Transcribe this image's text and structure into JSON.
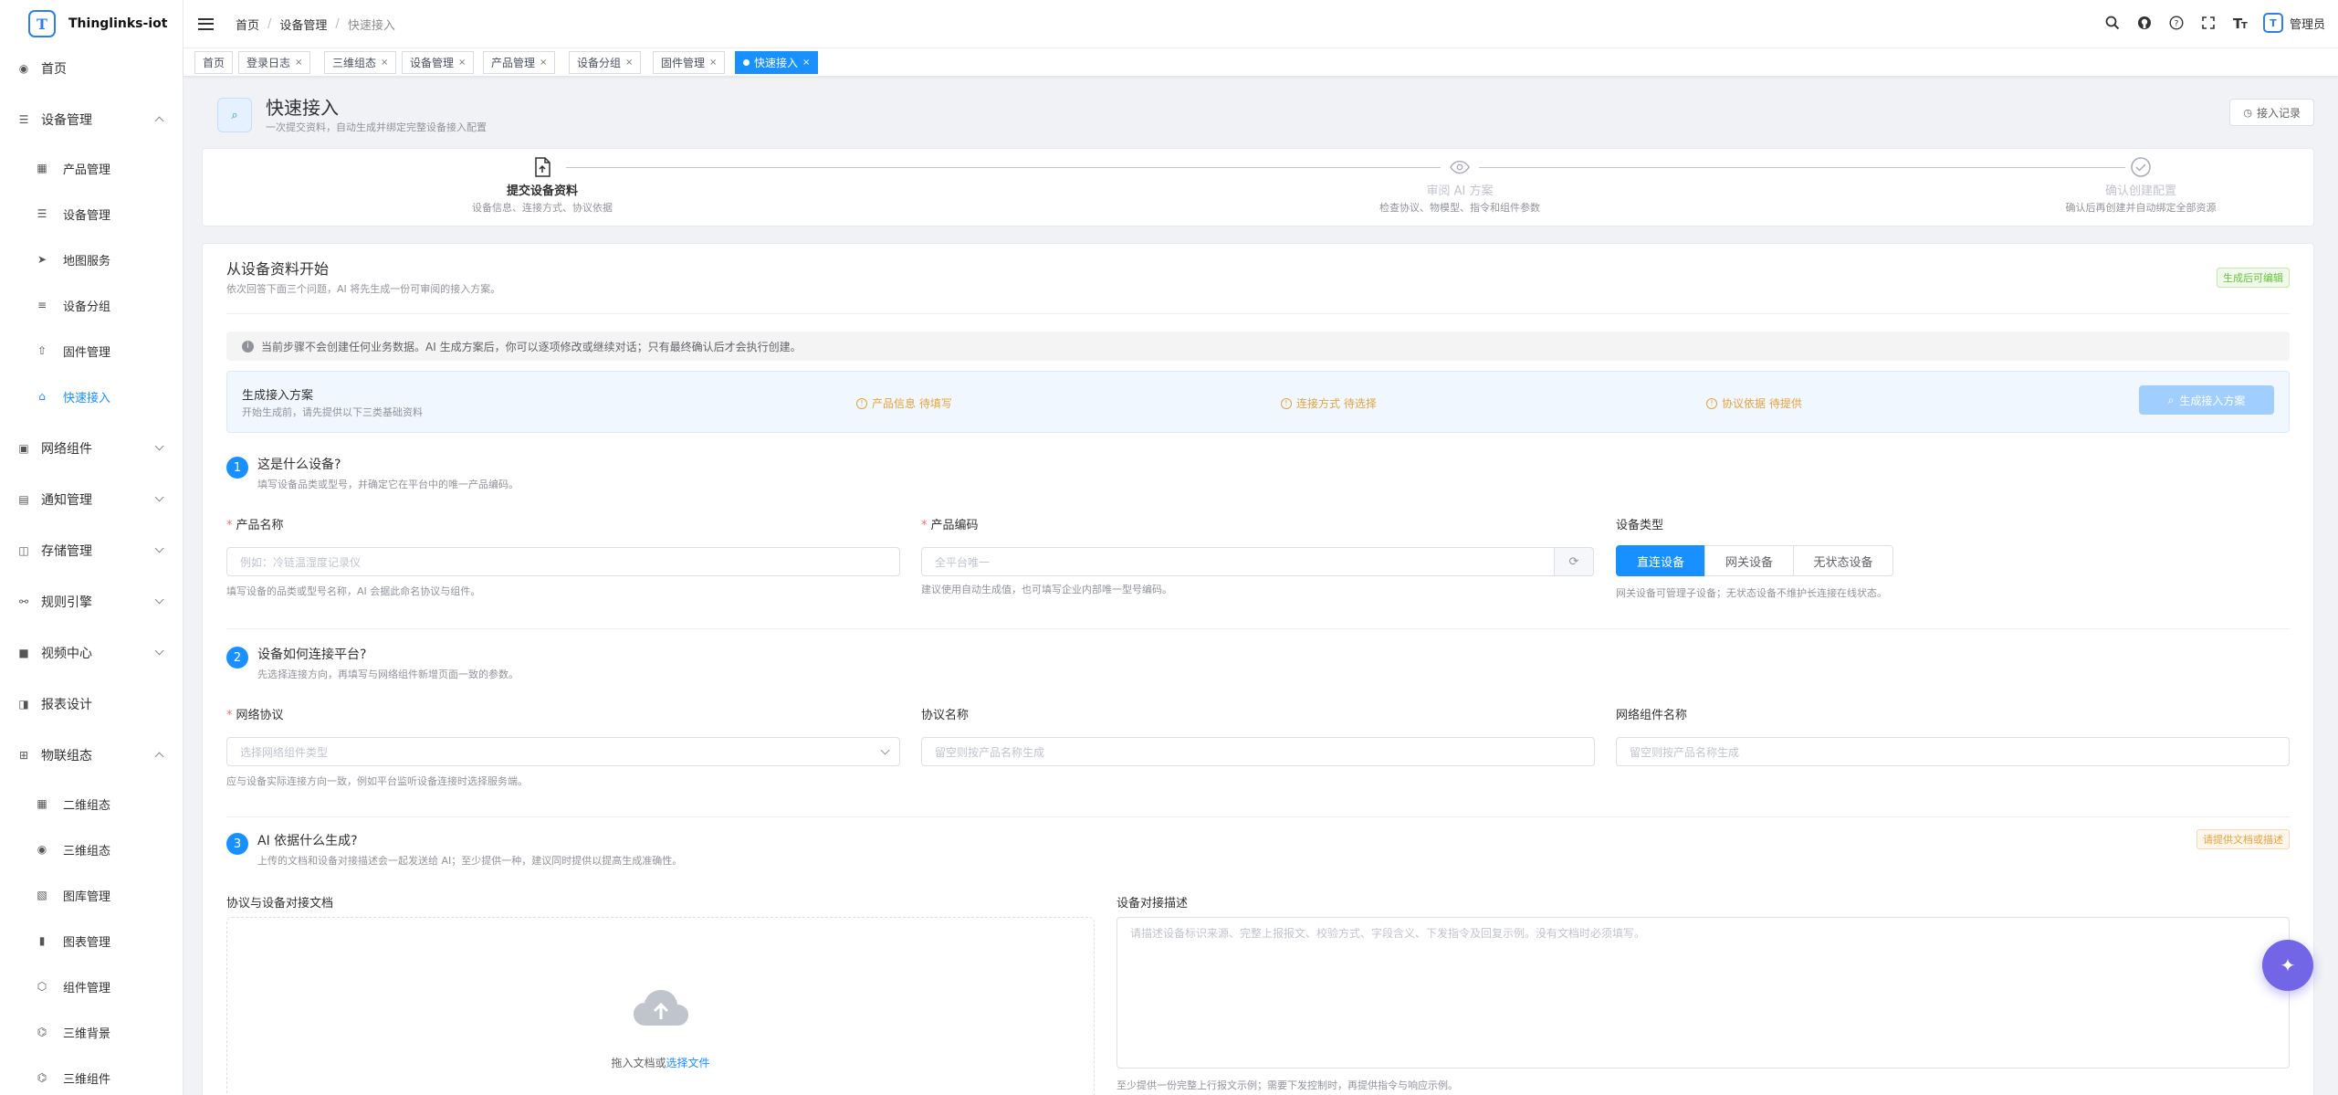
{
  "app": {
    "name": "Thinglinks-iot",
    "logo": "T"
  },
  "sidebar": {
    "items": [
      {
        "label": "首页",
        "icon": "dashboard-icon"
      },
      {
        "label": "设备管理",
        "icon": "device-stack-icon"
      },
      {
        "label": "产品管理",
        "icon": "grid-icon"
      },
      {
        "label": "设备管理",
        "icon": "device-stack-icon"
      },
      {
        "label": "地图服务",
        "icon": "send-icon"
      },
      {
        "label": "设备分组",
        "icon": "list-icon"
      },
      {
        "label": "固件管理",
        "icon": "upload-icon"
      },
      {
        "label": "快速接入",
        "icon": "home-icon"
      },
      {
        "label": "网络组件",
        "icon": "network-icon"
      },
      {
        "label": "通知管理",
        "icon": "message-icon"
      },
      {
        "label": "存储管理",
        "icon": "storage-icon"
      },
      {
        "label": "规则引擎",
        "icon": "rule-icon"
      },
      {
        "label": "视频中心",
        "icon": "video-icon"
      },
      {
        "label": "报表设计",
        "icon": "report-icon"
      },
      {
        "label": "物联组态",
        "icon": "config-icon"
      },
      {
        "label": "二维组态",
        "icon": "grid-icon"
      },
      {
        "label": "三维组态",
        "icon": "dashboard-icon"
      },
      {
        "label": "图库管理",
        "icon": "image-icon"
      },
      {
        "label": "图表管理",
        "icon": "bar-chart-icon"
      },
      {
        "label": "组件管理",
        "icon": "component-icon"
      },
      {
        "label": "三维背景",
        "icon": "background-icon"
      },
      {
        "label": "三维组件",
        "icon": "background-icon"
      }
    ]
  },
  "breadcrumb": [
    "首页",
    "设备管理",
    "快速接入"
  ],
  "header": {
    "admin": "管理员",
    "avatar": "T"
  },
  "tabs": [
    "首页",
    "登录日志",
    "三维组态",
    "设备管理",
    "产品管理",
    "设备分组",
    "固件管理",
    "快速接入"
  ],
  "page": {
    "title": "快速接入",
    "subtitle": "一次提交资料，自动生成并绑定完整设备接入配置",
    "records_btn": "接入记录"
  },
  "steps": [
    {
      "title": "提交设备资料",
      "desc": "设备信息、连接方式、协议依据"
    },
    {
      "title": "审阅 AI 方案",
      "desc": "检查协议、物模型、指令和组件参数"
    },
    {
      "title": "确认创建配置",
      "desc": "确认后再创建并自动绑定全部资源"
    }
  ],
  "form": {
    "title": "从设备资料开始",
    "subtitle": "依次回答下面三个问题，AI 将先生成一份可审阅的接入方案。",
    "badge": "生成后可编辑",
    "notice": "当前步骤不会创建任何业务数据。AI 生成方案后，你可以逐项修改或继续对话；只有最终确认后才会执行创建。",
    "gen": {
      "title": "生成接入方案",
      "sub": "开始生成前，请先提供以下三类基础资料",
      "s1": "产品信息 待填写",
      "s2": "连接方式 待选择",
      "s3": "协议依据 待提供",
      "btn": "生成接入方案"
    },
    "q1": {
      "num": "1",
      "title": "这是什么设备?",
      "desc": "填写设备品类或型号，并确定它在平台中的唯一产品编码。",
      "name_label": "产品名称",
      "name_ph": "例如：冷链温湿度记录仪",
      "name_hint": "填写设备的品类或型号名称，AI 会据此命名协议与组件。",
      "code_label": "产品编码",
      "code_ph": "全平台唯一",
      "code_hint": "建议使用自动生成值，也可填写企业内部唯一型号编码。",
      "type_label": "设备类型",
      "types": [
        "直连设备",
        "网关设备",
        "无状态设备"
      ],
      "type_hint": "网关设备可管理子设备；无状态设备不维护长连接在线状态。"
    },
    "q2": {
      "num": "2",
      "title": "设备如何连接平台?",
      "desc": "先选择连接方向，再填写与网络组件新增页面一致的参数。",
      "proto_label": "网络协议",
      "proto_ph": "选择网络组件类型",
      "proto_hint": "应与设备实际连接方向一致，例如平台监听设备连接时选择服务端。",
      "pname_label": "协议名称",
      "pname_ph": "留空则按产品名称生成",
      "comp_label": "网络组件名称",
      "comp_ph": "留空则按产品名称生成"
    },
    "q3": {
      "num": "3",
      "title": "AI 依据什么生成?",
      "desc": "上传的文档和设备对接描述会一起发送给 AI；至少提供一种，建议同时提供以提高生成准确性。",
      "badge": "请提供文档或描述",
      "doc_label": "协议与设备对接文档",
      "drop": "拖入文档或",
      "drop_link": "选择文件",
      "desc_label": "设备对接描述",
      "desc_ph": "请描述设备标识来源、完整上报报文、校验方式、字段含义、下发指令及回复示例。没有文档时必须填写。",
      "desc_hint": "至少提供一份完整上行报文示例；需要下发控制时，再提供指令与响应示例。"
    }
  },
  "colors": {
    "primary": "#1890ff",
    "warning": "#e6a23c",
    "success": "#67c23a",
    "fab": "#7265e6"
  }
}
